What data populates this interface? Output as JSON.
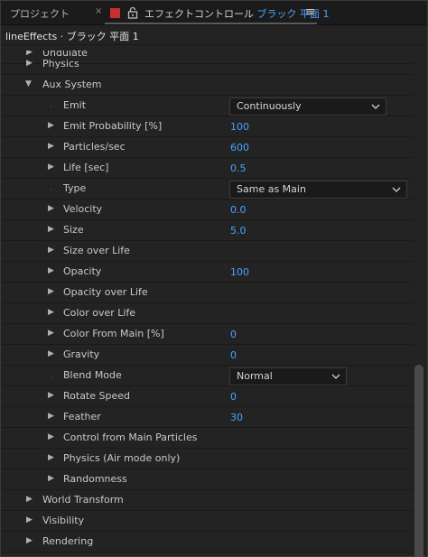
{
  "tabs": {
    "project_label": "プロジェクト",
    "close_glyph": "×",
    "effects_prefix": "エフェクトコントロール",
    "effects_layer": "ブラック 平面 1",
    "menu_glyph": "≡"
  },
  "layer_header": "lineEffects · ブラック 平面 1",
  "colors": {
    "accent_value": "#4aa3ff",
    "label_color": "#d6002a"
  },
  "props": {
    "undulate": "Undulate",
    "physics": "Physics",
    "aux_system": "Aux System",
    "emit": "Emit",
    "emit_value": "Continuously",
    "emit_probability": "Emit Probability [%]",
    "emit_probability_value": "100",
    "particles_sec": "Particles/sec",
    "particles_sec_value": "600",
    "life_sec": "Life [sec]",
    "life_sec_value": "0.5",
    "type": "Type",
    "type_value": "Same as Main",
    "velocity": "Velocity",
    "velocity_value": "0.0",
    "size": "Size",
    "size_value": "5.0",
    "size_over_life": "Size over Life",
    "opacity": "Opacity",
    "opacity_value": "100",
    "opacity_over_life": "Opacity over Life",
    "color_over_life": "Color over Life",
    "color_from_main": "Color From Main [%]",
    "color_from_main_value": "0",
    "gravity": "Gravity",
    "gravity_value": "0",
    "blend_mode": "Blend Mode",
    "blend_mode_value": "Normal",
    "rotate_speed": "Rotate Speed",
    "rotate_speed_value": "0",
    "feather": "Feather",
    "feather_value": "30",
    "control_from_main": "Control from Main Particles",
    "physics_air": "Physics (Air mode only)",
    "randomness": "Randomness",
    "world_transform": "World Transform",
    "visibility": "Visibility",
    "rendering": "Rendering"
  }
}
